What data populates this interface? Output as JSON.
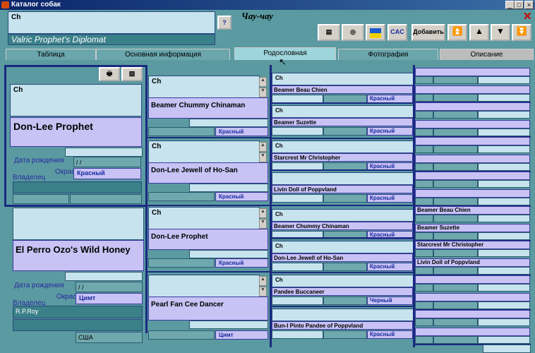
{
  "window": {
    "title": "Каталог собак"
  },
  "header": {
    "breed": "Чау-чау",
    "dog_title": "Ch",
    "dog_name": "Valric Prophet's Diplomat",
    "help": "?",
    "cac": "CAC",
    "add": "Добавить"
  },
  "tabs": [
    {
      "label": "Таблица"
    },
    {
      "label": "Основная информация"
    },
    {
      "label": "Родословная"
    },
    {
      "label": "Фотография"
    },
    {
      "label": "Описание"
    }
  ],
  "sire": {
    "title": "Ch",
    "name": "Don-Lee Prophet",
    "birth_label": "Дата рождения",
    "birth": "/ /",
    "color_label": "Окрас",
    "color": "Красный",
    "owner_label": "Владелец"
  },
  "dam": {
    "name": "El Perro Ozo's Wild Honey",
    "birth_label": "Дата рождения",
    "birth": "/ /",
    "color_label": "Окрас",
    "color": "Цимт",
    "owner_label": "Владелец",
    "owner": "R.P.Roy",
    "country": "США"
  },
  "gen2": [
    {
      "title": "Ch",
      "name": "Beamer Chummy Chinaman",
      "color": "Красный"
    },
    {
      "title": "Ch",
      "name": "Don-Lee Jewell of Ho-San",
      "color": "Красный"
    },
    {
      "title": "Ch",
      "name": "Don-Lee Prophet",
      "color": "Красный"
    },
    {
      "title": "",
      "name": "Pearl Fan Cee Dancer",
      "color": "Цимт"
    }
  ],
  "gen3": [
    {
      "title": "Ch",
      "name": "Beamer Beau Chien",
      "color": "Красный"
    },
    {
      "title": "Ch",
      "name": "Beamer Suzette",
      "color": "Красный"
    },
    {
      "title": "Ch",
      "name": "Starcrest Mr Christopher",
      "color": "Красный"
    },
    {
      "title": "",
      "name": "Livin Doll of Poppvland",
      "color": "Красный"
    },
    {
      "title": "Ch",
      "name": "Beamer Chummy Chinaman",
      "color": "Красный"
    },
    {
      "title": "Ch",
      "name": "Don-Lee Jewell of Ho-San",
      "color": "Красный"
    },
    {
      "title": "Ch",
      "name": "Pandee Buccaneer",
      "color": "Черный"
    },
    {
      "title": "",
      "name": "Bun-I Pinto Pandee of Poppvland",
      "color": "Красный"
    }
  ],
  "gen4": [
    "Beamer Beau Chien",
    "Beamer Suzette",
    "Starcrest Mr Christopher",
    "Livin Doll of Poppvland"
  ]
}
